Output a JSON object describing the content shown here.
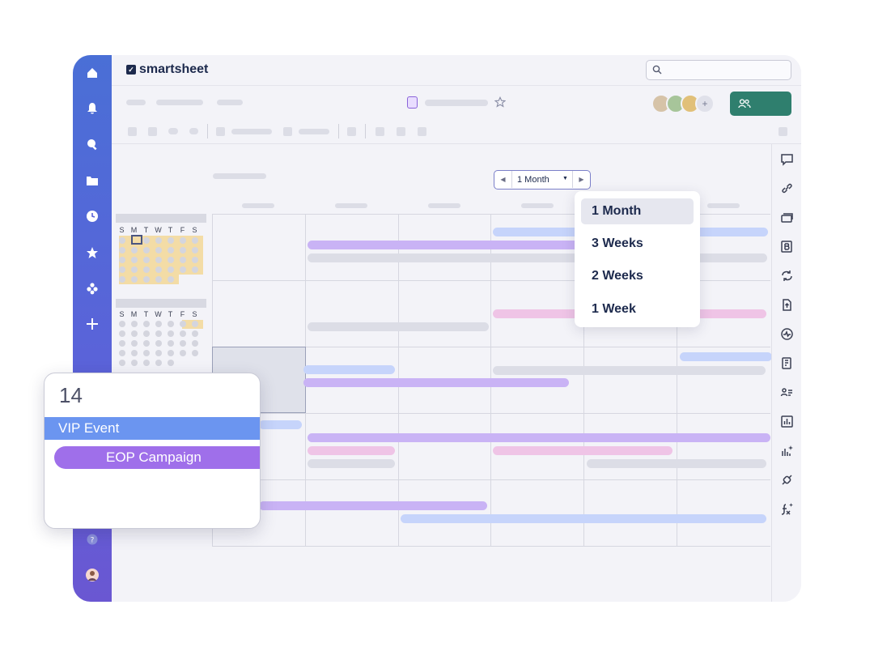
{
  "app": {
    "brand": "smartsheet",
    "brand_mark": "✓"
  },
  "colors": {
    "nav_top": "#4a6fd6",
    "nav_bottom": "#6a57d2",
    "share": "#2f7f6e",
    "blue_bar": "#c6d4fb",
    "purple_bar": "#c9b3f5",
    "pink_bar": "#efc4e6",
    "gray_bar": "#dcdde6"
  },
  "sidebar": {
    "icons": [
      "home-icon",
      "bell-icon",
      "search-icon",
      "folder-icon",
      "clock-icon",
      "star-icon",
      "apps-icon",
      "plus-icon",
      "help-icon",
      "user-avatar"
    ]
  },
  "calendar": {
    "range_label": "1 Month"
  },
  "range_menu": {
    "options": [
      "1 Month",
      "3 Weeks",
      "2 Weeks",
      "1 Week"
    ],
    "selected": "1 Month"
  },
  "mini_calendar": {
    "weekday_letters": [
      "S",
      "M",
      "T",
      "W",
      "T",
      "F",
      "S"
    ]
  },
  "day_popup": {
    "day": "14",
    "events": [
      "VIP Event",
      "EOP Campaign"
    ]
  },
  "right_panel": {
    "icons": [
      "comment-icon",
      "link-icon",
      "layers-icon",
      "brandfolder-icon",
      "sync-icon",
      "upload-icon",
      "activity-icon",
      "dashboard-icon",
      "people-icon",
      "chart-icon",
      "sparkle-chart-icon",
      "connector-icon",
      "formula-icon"
    ]
  }
}
